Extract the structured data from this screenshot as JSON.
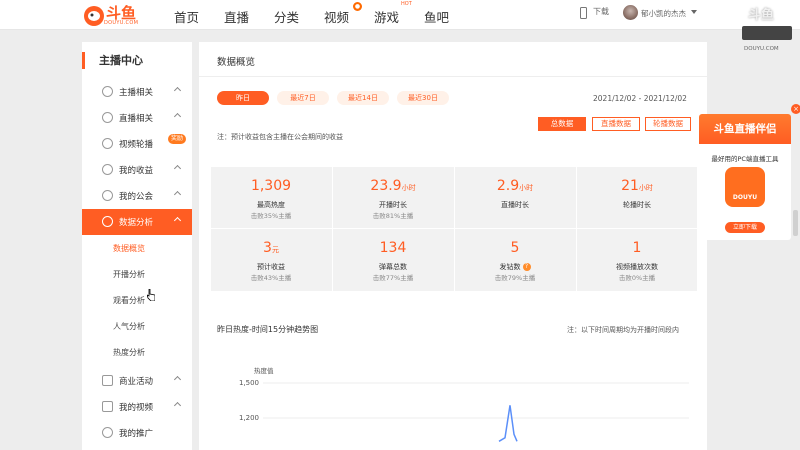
{
  "header": {
    "logo_text": "斗鱼",
    "logo_sub": "DOUYU.COM",
    "nav": [
      "首页",
      "直播",
      "分类",
      "视频",
      "游戏",
      "鱼吧"
    ],
    "video_badge": "●",
    "hot_tag": "HOT",
    "download_label": "下载",
    "username": "郁小凯的杰杰"
  },
  "watermark": {
    "logo": "斗鱼",
    "sub": "DOUYU.COM"
  },
  "sidebar": {
    "title": "主播中心",
    "items": [
      {
        "label": "主播相关",
        "icon": "mic-icon"
      },
      {
        "label": "直播相关",
        "icon": "video-icon"
      },
      {
        "label": "视频轮播",
        "icon": "loop-icon"
      },
      {
        "label": "我的收益",
        "icon": "coin-icon"
      },
      {
        "label": "我的公会",
        "icon": "shield-icon"
      },
      {
        "label": "数据分析",
        "icon": "clock-icon"
      }
    ],
    "hot_badge": "奖励",
    "sub_items": [
      "数据概览",
      "开播分析",
      "观看分析",
      "人气分析",
      "热度分析"
    ],
    "items_after": [
      {
        "label": "商业活动",
        "icon": "grid-icon"
      },
      {
        "label": "我的视频",
        "icon": "film-icon"
      },
      {
        "label": "我的推广",
        "icon": "mic-icon"
      }
    ]
  },
  "main": {
    "title": "数据概览",
    "ranges": [
      "昨日",
      "最近7日",
      "最近14日",
      "最近30日"
    ],
    "date_range": "2021/12/02 - 2021/12/02",
    "segments": [
      "总数据",
      "直播数据",
      "轮播数据"
    ],
    "note": "注：预计收益包含主播在公会期间的收益",
    "stats": [
      {
        "value": "1,309",
        "unit": "",
        "label": "最高热度",
        "sub": "击败35%主播"
      },
      {
        "value": "23.9",
        "unit": "小时",
        "label": "开播时长",
        "sub": "击败81%主播"
      },
      {
        "value": "2.9",
        "unit": "小时",
        "label": "直播时长",
        "sub": ""
      },
      {
        "value": "21",
        "unit": "小时",
        "label": "轮播时长",
        "sub": ""
      },
      {
        "value": "3",
        "unit": "元",
        "label": "预计收益",
        "sub": "击败43%主播"
      },
      {
        "value": "134",
        "unit": "",
        "label": "弹幕总数",
        "sub": "击败77%主播"
      },
      {
        "value": "5",
        "unit": "",
        "label": "发钻数",
        "sub": "击败79%主播"
      },
      {
        "value": "1",
        "unit": "",
        "label": "视频播放次数",
        "sub": "击败0%主播"
      }
    ],
    "chart_title": "昨日热度-时间15分钟趋势图",
    "chart_note": "注：以下时间周期均为开播时间段内"
  },
  "chart_data": {
    "type": "line",
    "title": "昨日热度-时间15分钟趋势图",
    "ylabel": "热度值",
    "yticks": [
      "1,500",
      "1,200"
    ],
    "ylim": [
      1000,
      1500
    ],
    "series": [
      {
        "values": [
          1000,
          1030,
          1309,
          1060,
          1000
        ]
      }
    ]
  },
  "ad": {
    "title": "斗鱼直播伴侣",
    "subtitle": "最好用的PC端直播工具",
    "icon_text": "DOUYU",
    "button": "立即下载",
    "close": "×"
  },
  "colors": {
    "accent": "#ff5d23",
    "line": "#5b8ff9"
  }
}
